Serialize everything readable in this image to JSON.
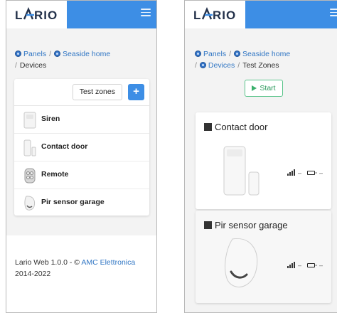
{
  "brand": {
    "logo": "LARIO",
    "accent": "#3d8ee5"
  },
  "left": {
    "breadcrumb": {
      "panels": "Panels",
      "home": "Seaside home",
      "current": "Devices"
    },
    "toolbar": {
      "test_zones": "Test zones",
      "add": "+"
    },
    "devices": [
      {
        "label": "Siren",
        "icon": "siren-icon"
      },
      {
        "label": "Contact door",
        "icon": "contact-door-icon"
      },
      {
        "label": "Remote",
        "icon": "remote-icon"
      },
      {
        "label": "Pir sensor garage",
        "icon": "pir-sensor-icon"
      }
    ],
    "footer": {
      "prefix": "Lario Web 1.0.0 - © ",
      "link": "AMC Elettronica",
      "suffix": " 2014-2022"
    }
  },
  "right": {
    "breadcrumb": {
      "panels": "Panels",
      "home": "Seaside home",
      "devices": "Devices",
      "current": "Test Zones"
    },
    "start_label": "Start",
    "zones": [
      {
        "name": "Contact door",
        "signal": "–",
        "battery": "–"
      },
      {
        "name": "Pir sensor garage",
        "signal": "–",
        "battery": "–"
      }
    ]
  }
}
